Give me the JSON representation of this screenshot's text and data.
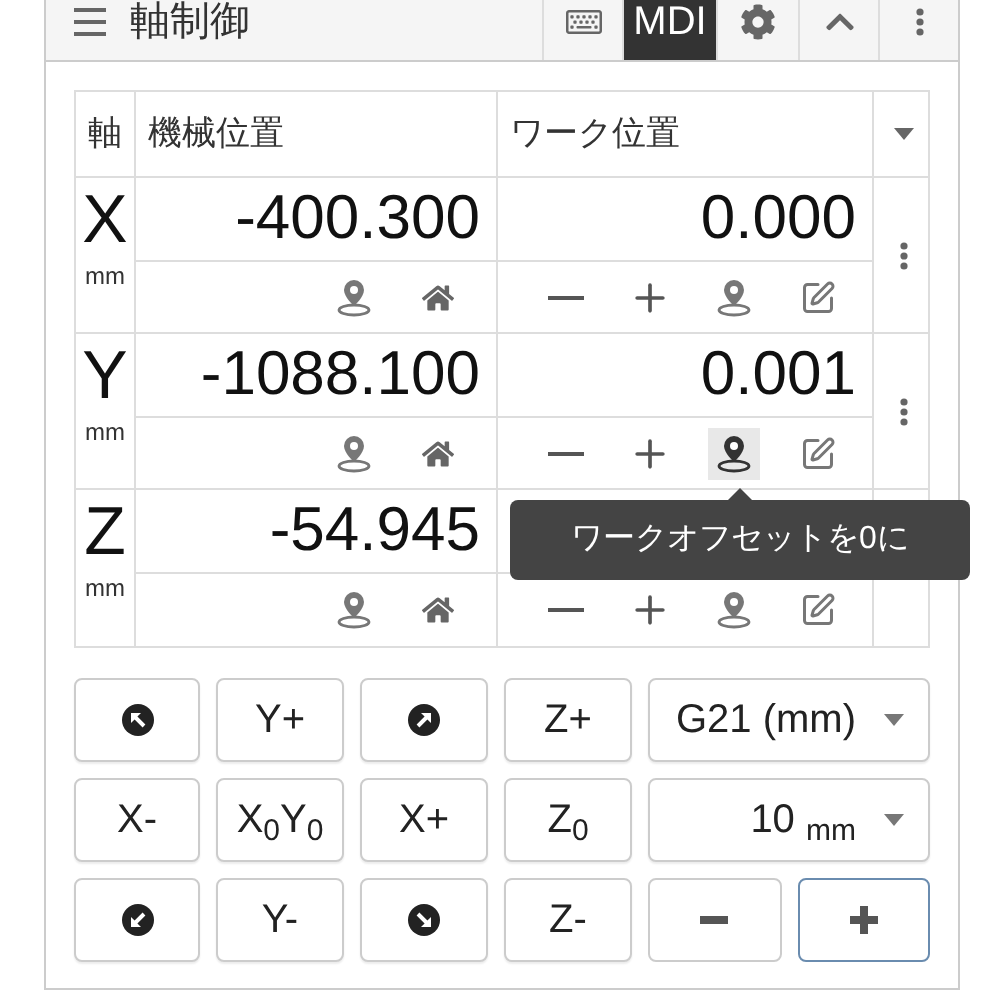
{
  "header": {
    "title": "軸制御",
    "buttons": [
      {
        "kind": "keyboard",
        "selected": false
      },
      {
        "kind": "text",
        "label": "MDI",
        "selected": true
      },
      {
        "kind": "gear",
        "selected": false
      },
      {
        "kind": "collapse",
        "selected": false
      },
      {
        "kind": "menu",
        "selected": false
      }
    ]
  },
  "table": {
    "columns": [
      "軸",
      "機械位置",
      "ワーク位置"
    ],
    "axes": [
      {
        "name": "X",
        "unit": "mm",
        "machine": "-400.300",
        "work": "0.000",
        "work_zero_hovered": false,
        "menu": true
      },
      {
        "name": "Y",
        "unit": "mm",
        "machine": "-1088.100",
        "work": "0.001",
        "work_zero_hovered": true,
        "menu": true
      },
      {
        "name": "Z",
        "unit": "mm",
        "machine": "-54.945",
        "work_zero_hovered": false,
        "menu": false
      }
    ]
  },
  "tooltip": "ワークオフセットを0に",
  "jog": {
    "rows": [
      [
        {
          "kind": "nw"
        },
        {
          "kind": "text",
          "label": "Y+"
        },
        {
          "kind": "ne"
        },
        {
          "kind": "text",
          "label": "Z+"
        },
        {
          "kind": "select",
          "value": "G21 (mm)"
        }
      ],
      [
        {
          "kind": "text",
          "label": "X-"
        },
        {
          "kind": "text",
          "label": "X$_{0}$Y$_{0}$"
        },
        {
          "kind": "text",
          "label": "X+"
        },
        {
          "kind": "text",
          "label": "Z$_{0}$"
        },
        {
          "kind": "select",
          "value": "10 $_{mm}$"
        }
      ],
      [
        {
          "kind": "sw"
        },
        {
          "kind": "text",
          "label": "Y-"
        },
        {
          "kind": "se"
        },
        {
          "kind": "text",
          "label": "Z-"
        },
        {
          "kind": "steps",
          "items": [
            {
              "kind": "decrease",
              "focused": false
            },
            {
              "kind": "increase",
              "focused": true
            }
          ]
        }
      ]
    ]
  }
}
